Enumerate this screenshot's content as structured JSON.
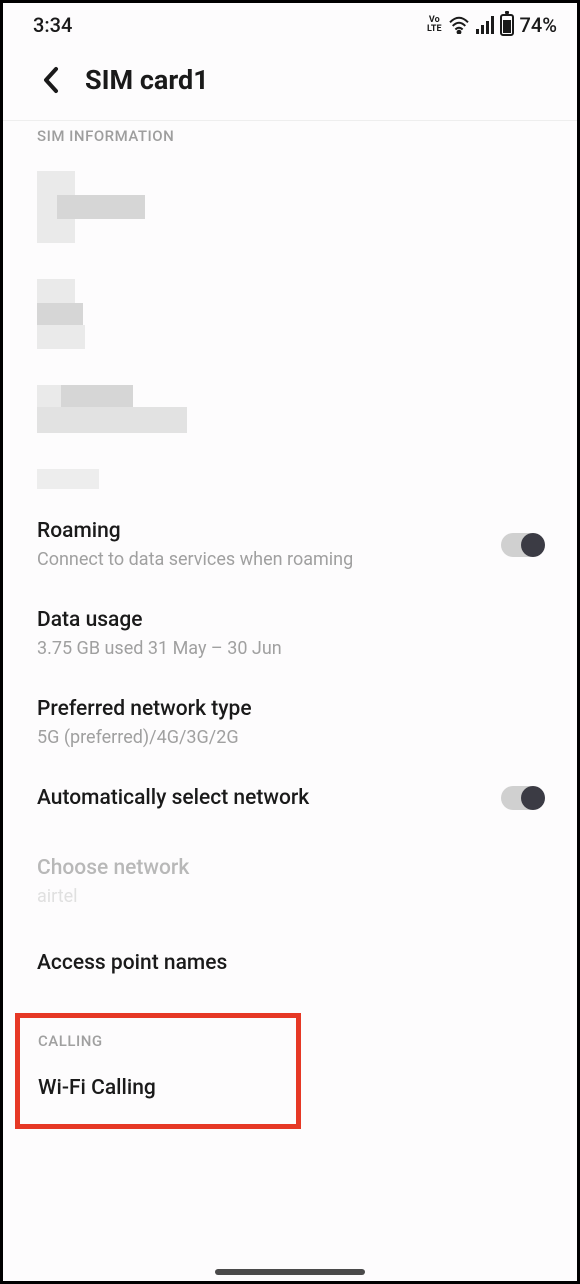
{
  "status_bar": {
    "time": "3:34",
    "volte": "VoLTE",
    "battery_percent": "74%"
  },
  "header": {
    "title": "SIM card1"
  },
  "sections": {
    "sim_info_header": "SIM INFORMATION",
    "calling_header": "CALLING"
  },
  "settings": {
    "roaming": {
      "title": "Roaming",
      "subtitle": "Connect to data services when roaming",
      "enabled": true
    },
    "data_usage": {
      "title": "Data usage",
      "subtitle": "3.75 GB used 31 May – 30 Jun"
    },
    "preferred_network": {
      "title": "Preferred network type",
      "subtitle": "5G (preferred)/4G/3G/2G"
    },
    "auto_select_network": {
      "title": "Automatically select network",
      "enabled": true
    },
    "choose_network": {
      "title": "Choose network",
      "subtitle": "airtel"
    },
    "apn": {
      "title": "Access point names"
    },
    "wifi_calling": {
      "title": "Wi-Fi Calling"
    }
  }
}
